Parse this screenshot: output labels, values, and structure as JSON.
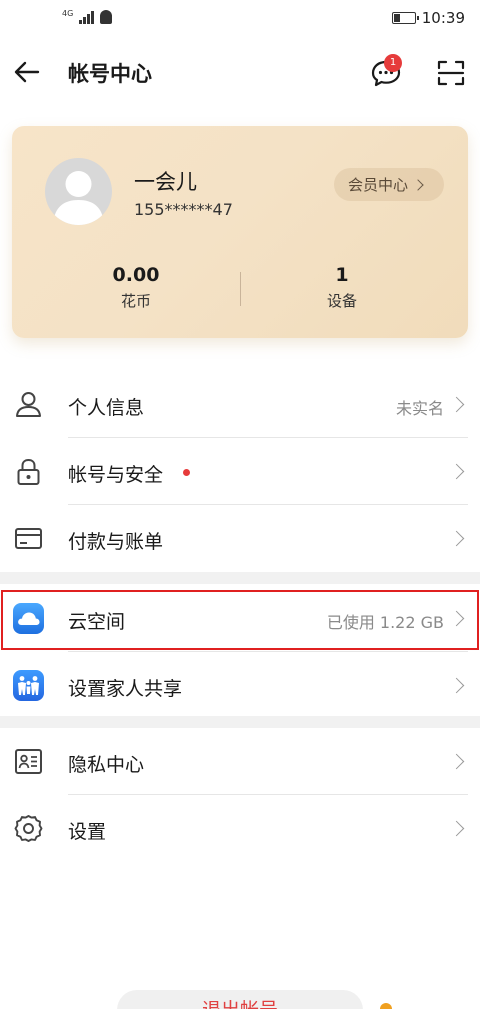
{
  "status_bar": {
    "network": "4G",
    "time": "10:39"
  },
  "header": {
    "title": "帐号中心",
    "message_badge": "1"
  },
  "account": {
    "name": "一会儿",
    "phone": "155******47",
    "vip_label": "会员中心",
    "stats": [
      {
        "value": "0.00",
        "label": "花币"
      },
      {
        "value": "1",
        "label": "设备"
      }
    ]
  },
  "menu": {
    "personal_info": {
      "label": "个人信息",
      "value": "未实名"
    },
    "account_security": {
      "label": "帐号与安全"
    },
    "payment": {
      "label": "付款与账单"
    },
    "cloud": {
      "label": "云空间",
      "value": "已使用 1.22 GB"
    },
    "family": {
      "label": "设置家人共享"
    },
    "privacy": {
      "label": "隐私中心"
    },
    "settings": {
      "label": "设置"
    }
  },
  "footer": {
    "logout_label": "退出帐号"
  },
  "colors": {
    "accent_red": "#e63b3b",
    "card_bg": "#f4e2c6",
    "highlight_border": "#e02020"
  }
}
